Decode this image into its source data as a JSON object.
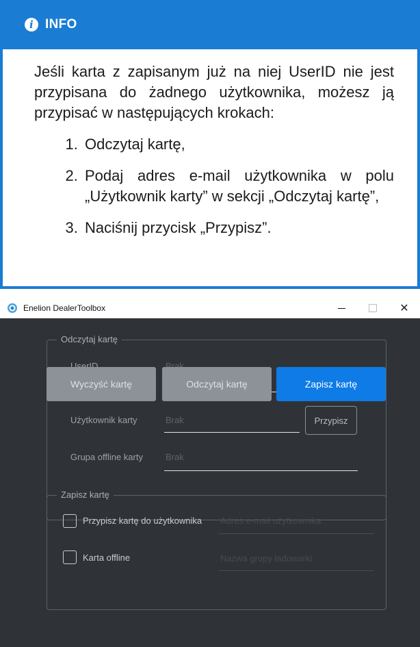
{
  "info": {
    "heading": "INFO",
    "icon": "info-circle-icon",
    "paragraph": "Jeśli karta z zapisanym już na niej UserID nie jest przypisana do żadnego użytkownika, może­sz ją przypisać w następujących krokach:",
    "steps": [
      "Odczytaj kartę,",
      "Podaj adres e-mail użytkownika w polu „Użytkownik karty” w sekcji „Odczytaj kartę”,",
      "Naciśnij przycisk „Przypisz”."
    ],
    "accent_color": "#1a7cd3"
  },
  "window": {
    "title": "Enelion DealerToolbox",
    "controls": {
      "minimize": "–",
      "maximize": "□",
      "close": "✕"
    },
    "background": "#2f3338"
  },
  "read_section": {
    "title": "Odczytaj kartę",
    "fields": [
      {
        "label": "UserID",
        "value": "Brak"
      },
      {
        "label": "Użytkownik karty",
        "value": "Brak"
      },
      {
        "label": "Grupa offline karty",
        "value": "Brak"
      }
    ],
    "assign_button": "Przypisz"
  },
  "write_section": {
    "title": "Zapisz kartę",
    "assign_checkbox_label": "Przypisz kartę do użytkownika",
    "email_placeholder": "Adres e-mail użytkownika",
    "offline_checkbox_label": "Karta offline",
    "group_placeholder": "Nazwa grupy ładowarki"
  },
  "buttons": {
    "clear": "Wyczyść kartę",
    "read": "Odczytaj kartę",
    "save": "Zapisz kartę",
    "save_color": "#0f7be6"
  }
}
